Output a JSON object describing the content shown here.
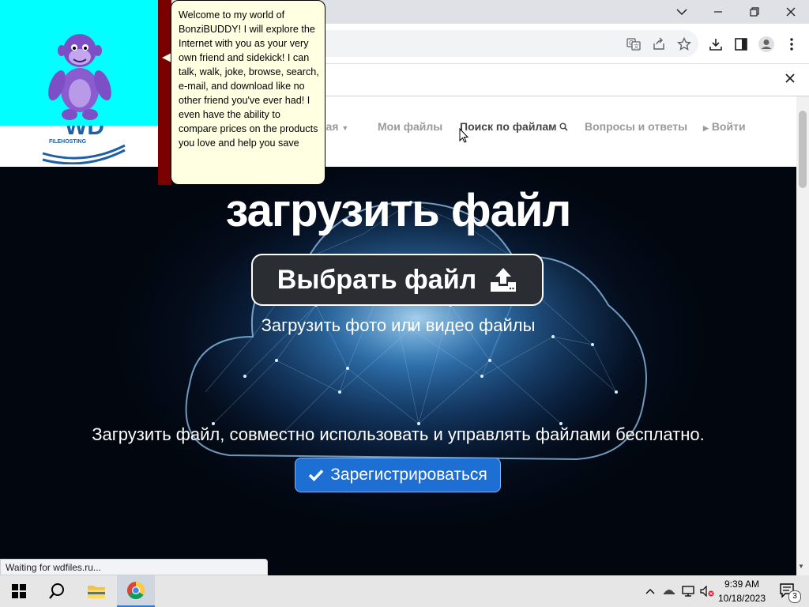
{
  "browser": {
    "window_controls": {
      "dropdown": "⌄",
      "minimize": "—",
      "restore": "❐",
      "close": "✕"
    },
    "infobar_close": "✕",
    "status_text": "Waiting for wdfiles.ru..."
  },
  "bonzi": {
    "speech": "Welcome to my world of BonziBUDDY! I will explore the Internet with you as your very own friend and sidekick! I can talk, walk, joke, browse, search, e-mail, and download like no other friend you've ever had! I even have the ability to compare prices on the products you love and help you save"
  },
  "site": {
    "logo_text": "WD",
    "logo_sub": "FILEHOSTING",
    "nav": {
      "home_partial": "ная",
      "my_files": "Мои файлы",
      "search_files": "Поиск по файлам",
      "faq": "Вопросы и ответы",
      "login": "Войти"
    },
    "hero": {
      "title": "загрузить файл",
      "choose_button": "Выбрать файл",
      "subtitle": "Загрузить фото или видео файлы",
      "description": "Загрузить файл, совместно использовать и управлять файлами бесплатно.",
      "register_button": "Зарегистрироваться"
    }
  },
  "taskbar": {
    "time": "9:39 AM",
    "date": "10/18/2023",
    "notification_count": "3"
  },
  "colors": {
    "bonzi_bg": "#00ffff",
    "accent_blue": "#1d6fd4",
    "hero_dark": "#040d1c"
  }
}
